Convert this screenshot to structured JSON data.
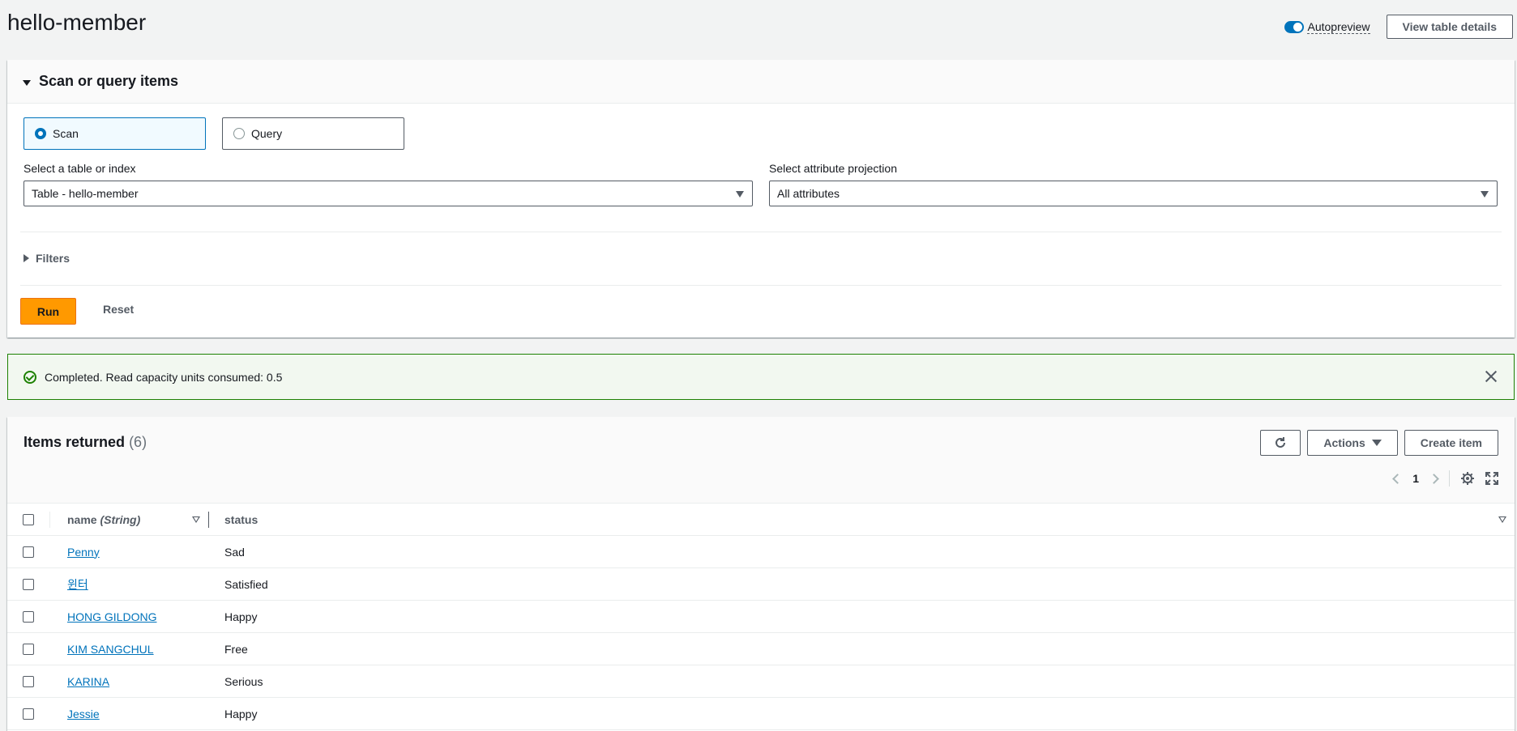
{
  "page": {
    "title": "hello-member",
    "autopreview_label": "Autopreview",
    "view_table_details": "View table details"
  },
  "scan_panel": {
    "title": "Scan or query items",
    "mode_scan": "Scan",
    "mode_query": "Query",
    "selected_mode": "Scan",
    "table_label": "Select a table or index",
    "table_value": "Table - hello-member",
    "projection_label": "Select attribute projection",
    "projection_value": "All attributes",
    "filters_label": "Filters",
    "run_label": "Run",
    "reset_label": "Reset"
  },
  "flash": {
    "message": "Completed. Read capacity units consumed: 0.5",
    "status_color": "#1d8102"
  },
  "items": {
    "title": "Items returned",
    "count": "(6)",
    "actions_label": "Actions",
    "create_label": "Create item",
    "page_number": "1",
    "columns": {
      "name": "name",
      "name_type": "(String)",
      "status": "status"
    },
    "rows": [
      {
        "name": "Penny",
        "status": "Sad"
      },
      {
        "name": "윈터",
        "status": "Satisfied"
      },
      {
        "name": "HONG GILDONG",
        "status": "Happy"
      },
      {
        "name": "KIM SANGCHUL",
        "status": "Free"
      },
      {
        "name": "KARINA",
        "status": "Serious"
      },
      {
        "name": "Jessie",
        "status": "Happy"
      }
    ]
  },
  "colors": {
    "primary": "#ff9900",
    "link": "#0073bb",
    "background": "#f2f3f3"
  }
}
